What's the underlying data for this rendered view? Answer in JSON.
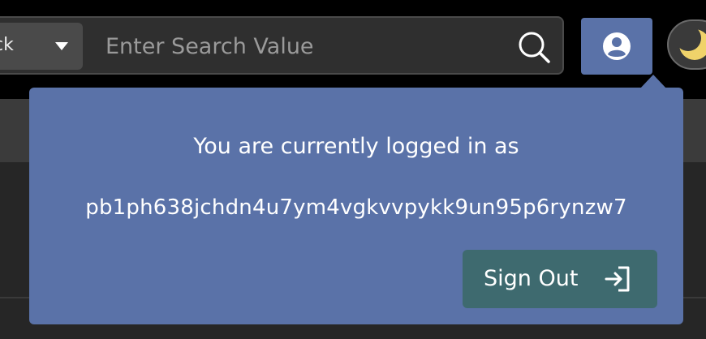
{
  "header": {
    "search_type_select": {
      "selected_value": "ck"
    },
    "search": {
      "placeholder": "Enter Search Value",
      "value": ""
    },
    "icons": {
      "search": "search-icon",
      "account": "user-circle-icon",
      "theme": "moon-icon"
    }
  },
  "account_popup": {
    "message": "You are currently logged in as",
    "username": "pb1ph638jchdn4u7ym4vgkvvpykk9un95p6rynzw7",
    "sign_out_label": "Sign Out",
    "sign_out_icon": "sign-out-icon"
  },
  "colors": {
    "popup_background": "#5a72a8",
    "sign_out_button": "#3e6a6f",
    "page_background": "#000000"
  }
}
